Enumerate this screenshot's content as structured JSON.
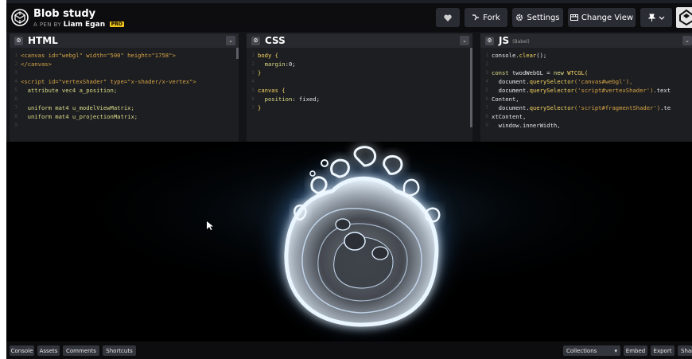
{
  "header": {
    "title": "Blob study",
    "byline_prefix": "A PEN BY",
    "author": "Liam Egan",
    "pro_badge": "PRO",
    "buttons": {
      "fork": "Fork",
      "settings": "Settings",
      "change_view": "Change View"
    }
  },
  "editors": {
    "html": {
      "title": "HTML",
      "lines": [
        [
          {
            "t": "<canvas ",
            "c": "tag"
          },
          {
            "t": "id=",
            "c": "attr"
          },
          {
            "t": "\"webgl\" ",
            "c": "str"
          },
          {
            "t": "width=",
            "c": "attr"
          },
          {
            "t": "\"500\" ",
            "c": "str"
          },
          {
            "t": "height=",
            "c": "attr"
          },
          {
            "t": "\"1758\"",
            "c": "str"
          },
          {
            "t": ">",
            "c": "tag"
          }
        ],
        [
          {
            "t": "</canvas>",
            "c": "tag"
          }
        ],
        [],
        [
          {
            "t": "<script ",
            "c": "tag"
          },
          {
            "t": "id=",
            "c": "attr"
          },
          {
            "t": "\"vertexShader\" ",
            "c": "str"
          },
          {
            "t": "type=",
            "c": "attr"
          },
          {
            "t": "\"x-shader/x-vertex\"",
            "c": "str"
          },
          {
            "t": ">",
            "c": "tag"
          }
        ],
        [
          {
            "t": "  attribute vec4 a_position;",
            "c": "kw"
          }
        ],
        [],
        [
          {
            "t": "  uniform mat4 u_modelViewMatrix;",
            "c": "kw"
          }
        ],
        [
          {
            "t": "  uniform mat4 u_projectionMatrix;",
            "c": "kw"
          }
        ],
        [
          {
            "t": "",
            "c": "kw"
          }
        ]
      ]
    },
    "css": {
      "title": "CSS",
      "lines": [
        [
          {
            "t": "body {",
            "c": "sel"
          }
        ],
        [
          {
            "t": "  margin",
            "c": "prop"
          },
          {
            "t": ":0;",
            "c": "val"
          }
        ],
        [
          {
            "t": "}",
            "c": "sel"
          }
        ],
        [],
        [
          {
            "t": "canvas {",
            "c": "sel"
          }
        ],
        [
          {
            "t": "  position",
            "c": "prop"
          },
          {
            "t": ": fixed;",
            "c": "val"
          }
        ],
        [
          {
            "t": "}",
            "c": "sel"
          }
        ]
      ]
    },
    "js": {
      "title": "JS",
      "subtitle": "(Babel)",
      "lines": [
        [
          {
            "t": "console.",
            "c": "val"
          },
          {
            "t": "clear",
            "c": "mth"
          },
          {
            "t": "();",
            "c": "val"
          }
        ],
        [],
        [
          {
            "t": "const ",
            "c": "kw"
          },
          {
            "t": "twodWebGL = ",
            "c": "val"
          },
          {
            "t": "new ",
            "c": "kw"
          },
          {
            "t": "WTCGL(",
            "c": "mth"
          }
        ],
        [
          {
            "t": "  document.",
            "c": "val"
          },
          {
            "t": "querySelector",
            "c": "mth"
          },
          {
            "t": "('canvas#webgl'),",
            "c": "str"
          }
        ],
        [
          {
            "t": "  document.",
            "c": "val"
          },
          {
            "t": "querySelector",
            "c": "mth"
          },
          {
            "t": "('script#vertexShader')",
            "c": "str"
          },
          {
            "t": ".text",
            "c": "val"
          }
        ],
        [
          {
            "t": "Content,",
            "c": "val"
          }
        ],
        [
          {
            "t": "  document.",
            "c": "val"
          },
          {
            "t": "querySelector",
            "c": "mth"
          },
          {
            "t": "('script#fragmentShader')",
            "c": "str"
          },
          {
            "t": ".te",
            "c": "val"
          }
        ],
        [
          {
            "t": "xtContent,",
            "c": "val"
          }
        ],
        [
          {
            "t": "  window.innerWidth,",
            "c": "val"
          }
        ]
      ]
    }
  },
  "footer": {
    "left": [
      "Console",
      "Assets",
      "Comments",
      "Shortcuts"
    ],
    "right": [
      "Collections",
      "Embed",
      "Export",
      "Share"
    ]
  },
  "colors": {
    "bg": "#1e1f26",
    "header_bg": "#0d0d10",
    "button_bg": "#2a2c34",
    "pro_badge": "#f0c419",
    "glow": "#9fd4ff"
  }
}
